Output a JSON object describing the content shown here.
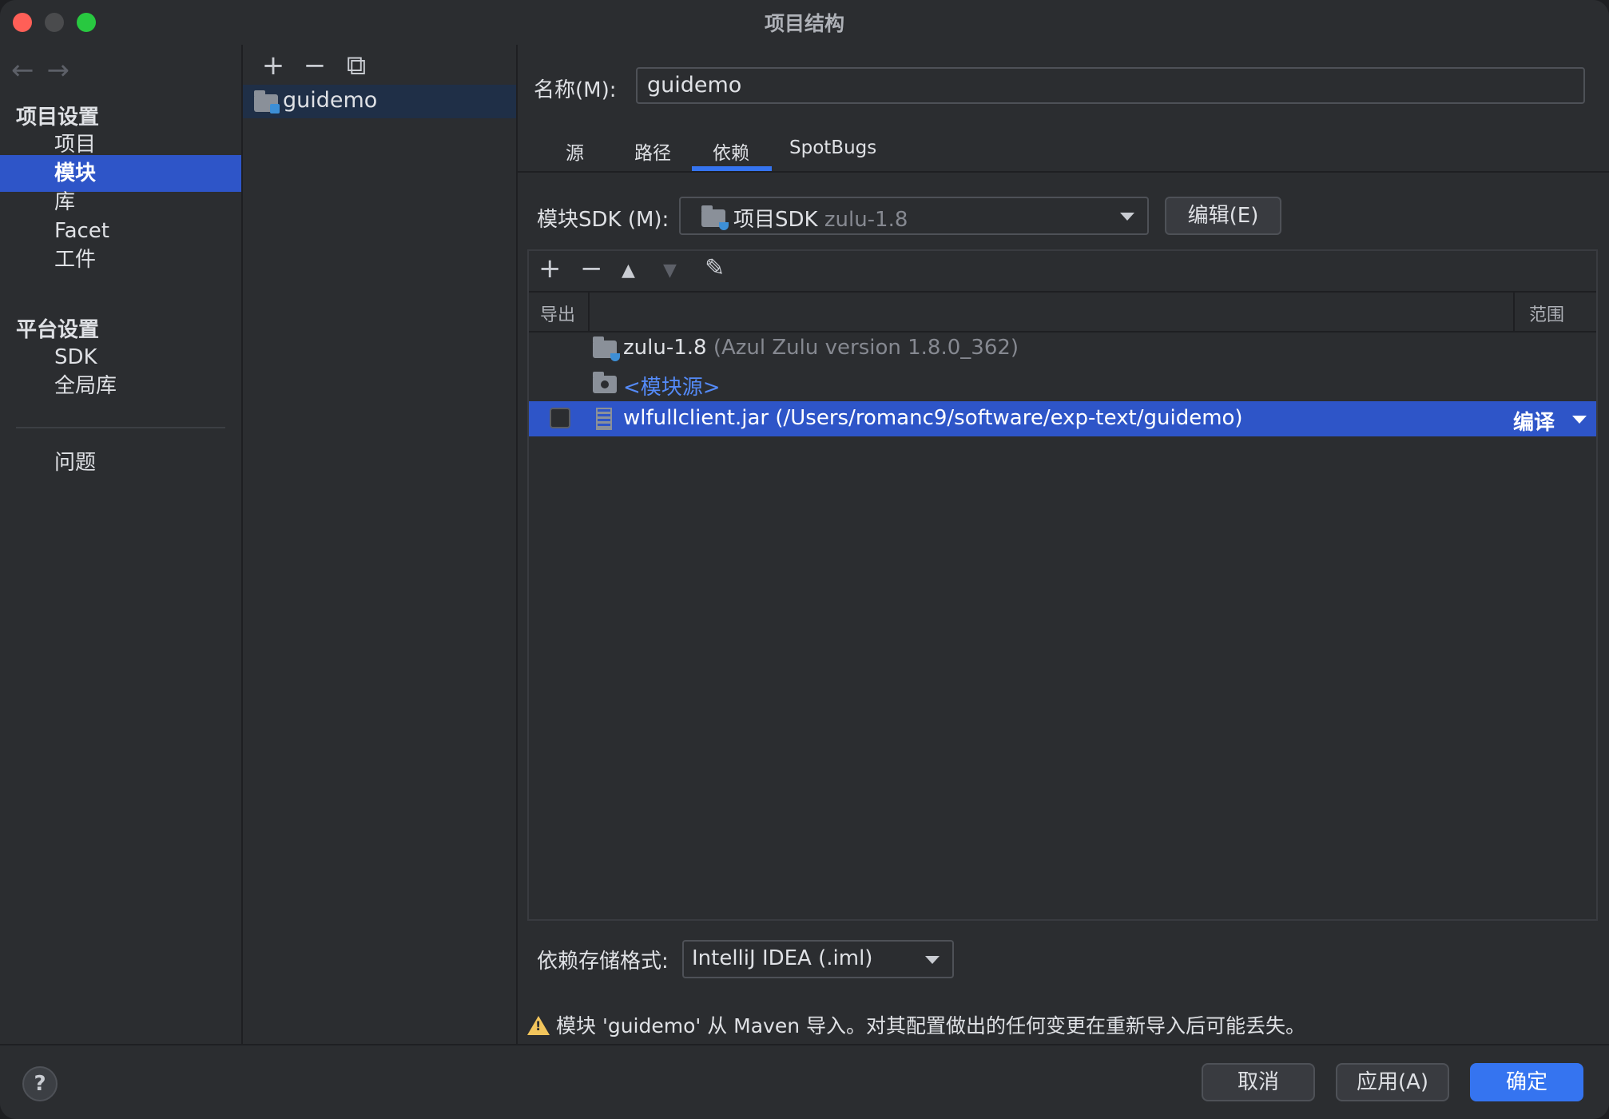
{
  "window": {
    "title": "项目结构"
  },
  "nav": {
    "back_icon": "←",
    "forward_icon": "→"
  },
  "sidebar": {
    "project_settings_header": "项目设置",
    "project_items": [
      "项目",
      "模块",
      "库",
      "Facet",
      "工件"
    ],
    "selected": "模块",
    "platform_settings_header": "平台设置",
    "platform_items": [
      "SDK",
      "全局库"
    ],
    "problems": "问题"
  },
  "modules": {
    "toolbar": {
      "add": "+",
      "remove": "−",
      "copy": "⧉"
    },
    "items": [
      "guidemo"
    ]
  },
  "detail": {
    "name_label": "名称(M):",
    "name_value": "guidemo",
    "tabs": [
      "源",
      "路径",
      "依赖",
      "SpotBugs"
    ],
    "active_tab": "依赖",
    "sdk_label": "模块SDK (M):",
    "sdk_value_main": "项目SDK",
    "sdk_value_dim": "zulu-1.8",
    "edit_button": "编辑(E)",
    "deps_toolbar": {
      "add": "+",
      "remove": "−",
      "up": "▲",
      "down": "▼",
      "edit": "✎"
    },
    "columns": {
      "export": "导出",
      "scope": "范围"
    },
    "rows": [
      {
        "name": "zulu-1.8",
        "detail": "(Azul Zulu version 1.8.0_362)"
      },
      {
        "name": "<模块源>"
      },
      {
        "name": "wlfullclient.jar (/Users/romanc9/software/exp-text/guidemo)",
        "scope": "编译",
        "selected": true,
        "exported": false
      }
    ],
    "format_label": "依赖存储格式:",
    "format_value": "IntelliJ IDEA (.iml)",
    "warning": "模块 'guidemo' 从 Maven 导入。对其配置做出的任何变更在重新导入后可能丢失。"
  },
  "footer": {
    "help": "?",
    "cancel": "取消",
    "apply": "应用(A)",
    "ok": "确定"
  },
  "colors": {
    "selection": "#2e55c8",
    "accent": "#3574f0",
    "link": "#548af7",
    "warning": "#f2c55c"
  }
}
